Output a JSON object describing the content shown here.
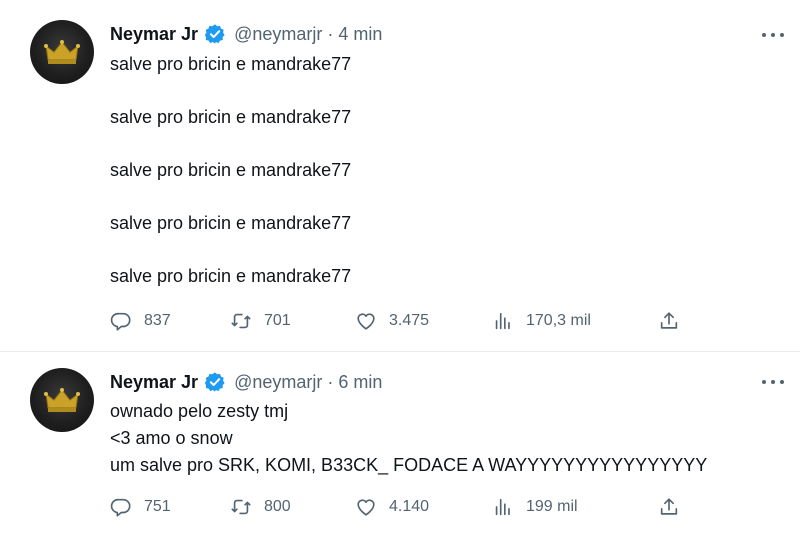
{
  "tweets": [
    {
      "author": {
        "name": "Neymar Jr",
        "handle": "@neymarjr",
        "separator": "·",
        "time": "4 min",
        "verified": true
      },
      "lines": [
        "salve pro bricin e mandrake77",
        "salve pro bricin e mandrake77",
        "salve pro bricin e mandrake77",
        "salve pro bricin e mandrake77",
        "salve pro bricin e mandrake77"
      ],
      "stats": {
        "replies": "837",
        "retweets": "701",
        "likes": "3.475",
        "views": "170,3 mil"
      }
    },
    {
      "author": {
        "name": "Neymar Jr",
        "handle": "@neymarjr",
        "separator": "·",
        "time": "6 min",
        "verified": true
      },
      "lines": [
        "ownado pelo zesty tmj",
        "<3 amo o snow",
        "um salve pro SRK, KOMI, B33CK_ FODACE A WAYYYYYYYYYYYYYYYY"
      ],
      "stats": {
        "replies": "751",
        "retweets": "800",
        "likes": "4.140",
        "views": "199 mil"
      }
    }
  ],
  "colors": {
    "text": "#0f1419",
    "muted": "#536471",
    "verified": "#1d9bf0",
    "divider": "#e6ecf0"
  },
  "icons": [
    "reply-icon",
    "retweet-icon",
    "like-icon",
    "views-icon",
    "share-icon",
    "verified-icon",
    "more-icon"
  ]
}
